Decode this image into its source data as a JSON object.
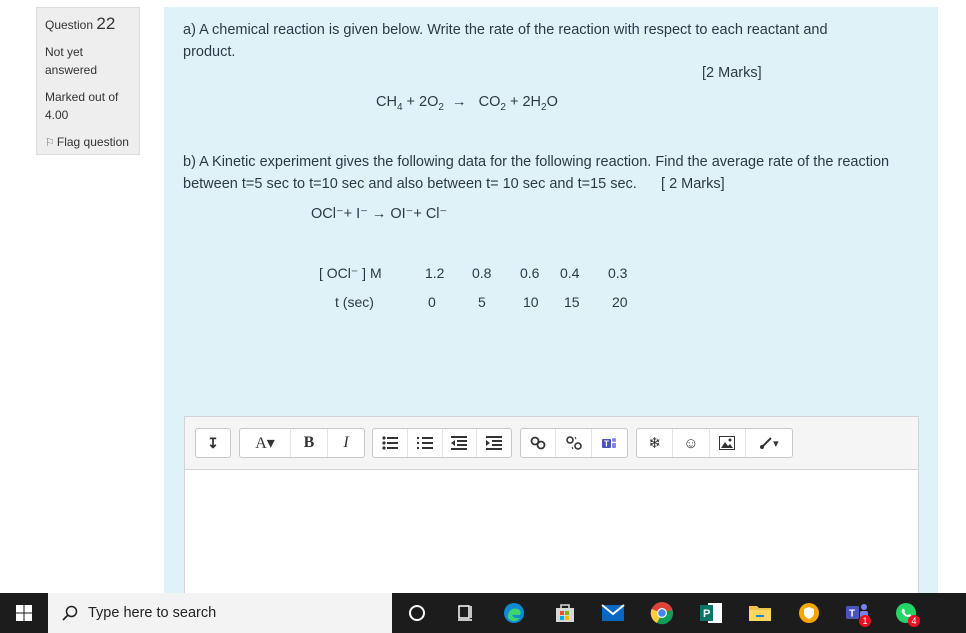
{
  "info": {
    "question_prefix": "Question",
    "question_number": "22",
    "state": "Not yet answered",
    "grade": "Marked out of 4.00",
    "flag_label": "Flag question"
  },
  "question": {
    "part_a_text": "a) A chemical reaction is given below. Write the rate of the reaction with respect to each reactant and product.",
    "part_a_marks": "[2 Marks]",
    "equation_a": {
      "ch4": "CH",
      "ch4_sub": "4",
      "plus1": "+ 2O",
      "o2_sub": "2",
      "arrow": "→",
      "co2": "CO",
      "co2_sub": "2",
      "plus2": "+ 2H",
      "h2o_sub": "2",
      "h2o_end": "O"
    },
    "part_b_text": "b)  A Kinetic experiment gives the following data for the following reaction. Find the average rate of the reaction between t=5 sec to t=10 sec and also between t= 10 sec and t=15 sec.",
    "part_b_marks": "[ 2 Marks]",
    "equation_b": "OCl⁻+ I⁻  → OI⁻+ Cl⁻",
    "table": {
      "row1_label": "[ OCl⁻ ] M",
      "row1_values": [
        "1.2",
        "0.8",
        "0.6",
        "0.4",
        "0.3"
      ],
      "row2_label": "t (sec)",
      "row2_values": [
        "0",
        "5",
        "10",
        "15",
        "20"
      ]
    }
  },
  "editor": {
    "toolbar": {
      "collapse": "↧",
      "font_color": "A▾",
      "bold": "B",
      "italic": "I",
      "more": "▾"
    }
  },
  "taskbar": {
    "search_placeholder": "Type here to search",
    "teams_badge": "1",
    "whatsapp_badge": "4"
  }
}
